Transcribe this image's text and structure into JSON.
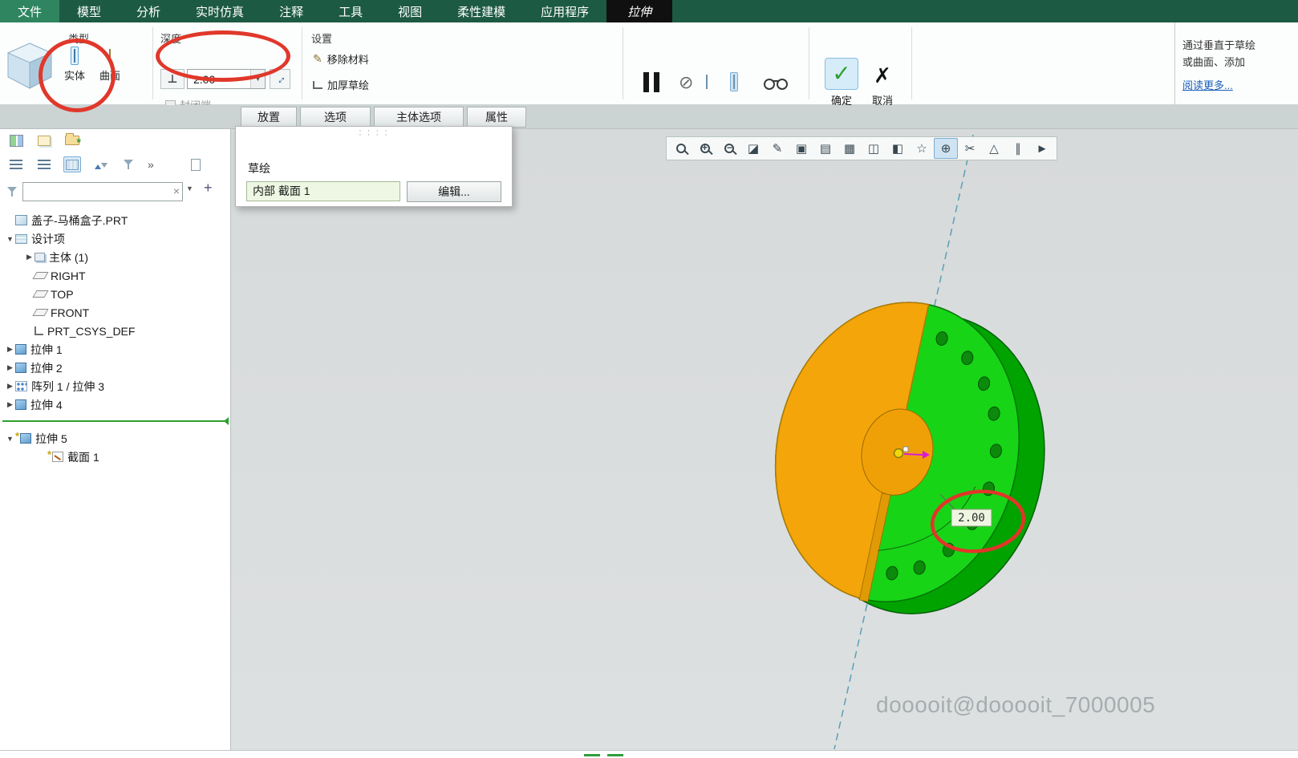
{
  "menubar": {
    "items": [
      "文件",
      "模型",
      "分析",
      "实时仿真",
      "注释",
      "工具",
      "视图",
      "柔性建模",
      "应用程序"
    ],
    "active_tab": "拉伸"
  },
  "ribbon": {
    "type_group": {
      "label": "类型",
      "solid": "实体",
      "surface": "曲面"
    },
    "depth_group": {
      "label": "深度",
      "value": "2.00",
      "capped": "封闭端"
    },
    "settings_group": {
      "label": "设置",
      "remove_material": "移除材料",
      "thicken": "加厚草绘"
    },
    "actions": {
      "ok": "确定",
      "cancel": "取消"
    }
  },
  "help_panel": {
    "line1": "通过垂直于草绘",
    "line2": "或曲面、添加",
    "read_more": "阅读更多..."
  },
  "dashboard_tabs": [
    "放置",
    "选项",
    "主体选项",
    "属性"
  ],
  "placement_panel": {
    "sketch_label": "草绘",
    "sketch_ref": "内部 截面 1",
    "edit": "编辑..."
  },
  "model_tree": {
    "nodes": [
      {
        "label": "盖子-马桶盒子.PRT",
        "expander": ""
      },
      {
        "label": "设计项",
        "expander": "▼"
      },
      {
        "label": "主体 (1)",
        "expander": "▶"
      },
      {
        "label": "RIGHT",
        "expander": ""
      },
      {
        "label": "TOP",
        "expander": ""
      },
      {
        "label": "FRONT",
        "expander": ""
      },
      {
        "label": "PRT_CSYS_DEF",
        "expander": ""
      },
      {
        "label": "拉伸 1",
        "expander": "▶"
      },
      {
        "label": "拉伸 2",
        "expander": "▶"
      },
      {
        "label": "阵列 1 / 拉伸 3",
        "expander": "▶"
      },
      {
        "label": "拉伸 4",
        "expander": "▶"
      },
      {
        "label": "拉伸 5",
        "expander": "▼"
      },
      {
        "label": "截面 1",
        "expander": ""
      }
    ]
  },
  "viewport": {
    "dimension": "2.00",
    "watermark": "dooooit@dooooit_7000005"
  },
  "graphics_toolbar": {
    "glyphs": [
      "◪",
      "✎",
      "▣",
      "▤",
      "▦",
      "◫",
      "◧",
      "☆",
      "⊕",
      "✂",
      "△",
      "∥",
      "►"
    ]
  },
  "icons": {
    "no_preview": "⊘",
    "check": "✓",
    "cross": "✗",
    "overflow": "»",
    "add": "+",
    "clear": "×",
    "dropdown": "▼",
    "depth_type": "⊥",
    "flip": "↔",
    "pencil": "✎",
    "pending": "*"
  },
  "colors": {
    "accent_green": "#17d417",
    "accent_orange": "#f4a50a",
    "annotation_red": "#e0382b"
  }
}
